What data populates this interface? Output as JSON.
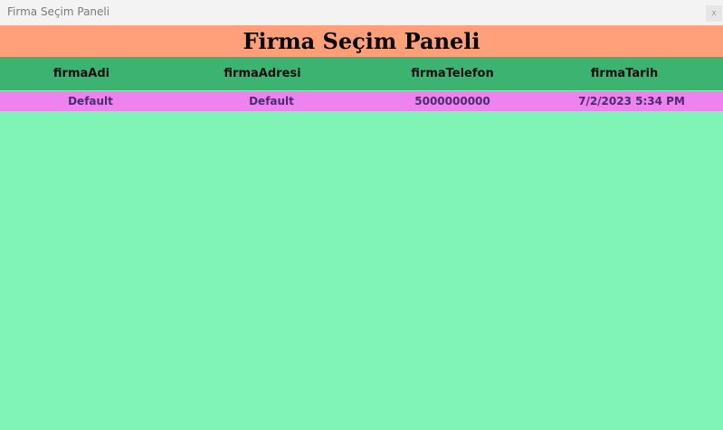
{
  "window": {
    "title": "Firma Seçim Paneli",
    "close_label": "x"
  },
  "header": {
    "title": "Firma Seçim Paneli"
  },
  "grid": {
    "columns": [
      "firmaAdi",
      "firmaAdresi",
      "firmaTelefon",
      "firmaTarih"
    ],
    "rows": [
      [
        "Default",
        "Default",
        "5000000000",
        "7/2/2023 5:34 PM"
      ]
    ]
  },
  "colors": {
    "title_bar": "#f3f3f3",
    "header_banner": "#ffa07a",
    "column_header": "#3cb371",
    "row_background": "#ee82ee",
    "row_text": "#4b2c72",
    "body_background": "#80f4b6"
  }
}
